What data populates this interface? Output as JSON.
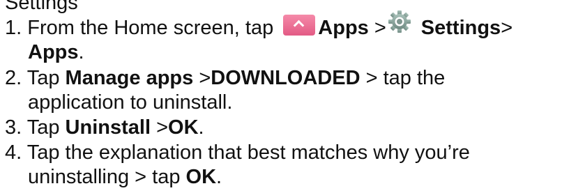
{
  "partial_top_text": "Settings",
  "steps": [
    {
      "number": "1.",
      "t1": " From the Home screen, tap ",
      "apps_icon": "apps-chevron-up-icon",
      "b1": "Apps",
      "t2": " >",
      "settings_icon": "settings-gear-icon",
      "b2": "Settings",
      "t3": ">",
      "b3": "Apps",
      "t4": "."
    },
    {
      "number": "2.",
      "t1": " Tap ",
      "b1": "Manage apps",
      "t2": " >",
      "b2": "DOWNLOADED",
      "t3": " > tap the",
      "t4": "application to uninstall."
    },
    {
      "number": "3.",
      "t1": " Tap ",
      "b1": "Uninstall",
      "t2": " >",
      "b2": "OK",
      "t3": "."
    },
    {
      "number": "4.",
      "t1": " Tap the explanation that best matches why you’re",
      "t2": "uninstalling > tap ",
      "b1": "OK",
      "t3": "."
    }
  ],
  "colors": {
    "text": "#111111",
    "apps_icon": "#e8678f",
    "settings_icon": "#8aa29a"
  }
}
